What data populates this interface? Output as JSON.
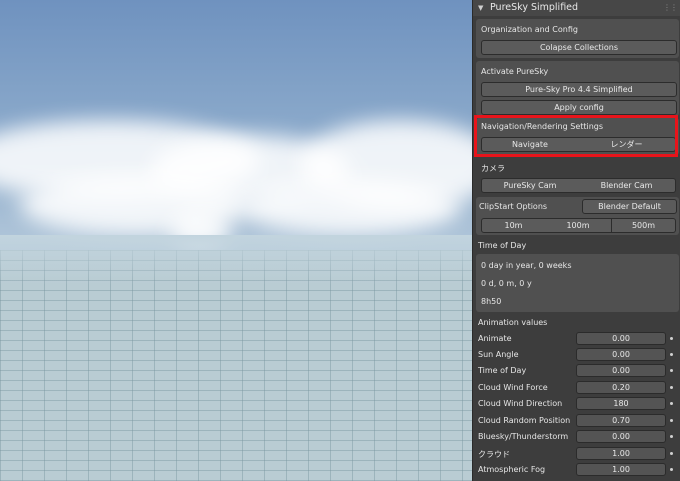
{
  "panel": {
    "title": "PureSky Simplified",
    "collapse_icon": "triangle-down-icon",
    "grip_icon": "grip-dots-icon"
  },
  "org": {
    "label": "Organization and Config",
    "collapse_button": "Colapse Collections"
  },
  "activate": {
    "label": "Activate PureSky",
    "preset_button": "Pure-Sky Pro 4.4 Simplified",
    "apply_button": "Apply config"
  },
  "nav": {
    "label": "Navigation/Rendering Settings",
    "navigate_button": "Navigate",
    "render_button": "レンダー",
    "highlight_color": "#e8141b"
  },
  "camera": {
    "label": "カメラ",
    "puresky_cam": "PureSky Cam",
    "blender_cam": "Blender Cam"
  },
  "clipstart": {
    "label": "ClipStart Options",
    "default_button": "Blender Default",
    "options": [
      "10m",
      "100m",
      "500m"
    ]
  },
  "time": {
    "label": "Time of Day",
    "line1": "0 day in year, 0 weeks",
    "line2": "0 d, 0 m, 0 y",
    "line3": "8h50"
  },
  "animation": {
    "label": "Animation values",
    "rows": [
      {
        "label": "Animate",
        "value": "0.00"
      },
      {
        "label": "Sun Angle",
        "value": "0.00"
      },
      {
        "label": "Time of Day",
        "value": "0.00"
      },
      {
        "label": "Cloud Wind Force",
        "value": "0.20"
      },
      {
        "label": "Cloud Wind Direction",
        "value": "180"
      },
      {
        "label": "Cloud Random Position",
        "value": "0.70"
      },
      {
        "label": "Bluesky/Thunderstorm",
        "value": "0.00"
      },
      {
        "label": "クラウド",
        "value": "1.00"
      },
      {
        "label": "Atmospheric Fog",
        "value": "1.00"
      }
    ]
  }
}
